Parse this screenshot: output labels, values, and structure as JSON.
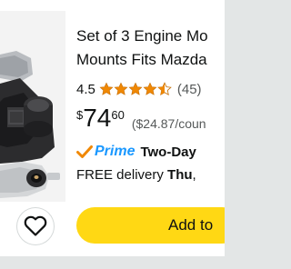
{
  "product": {
    "title_line1": "Set of 3 Engine Mo",
    "title_line2": "Mounts Fits Mazda",
    "rating_value": "4.5",
    "rating_stars": 4.5,
    "review_count": "(45)",
    "price_currency": "$",
    "price_whole": "74",
    "price_fraction": "60",
    "unit_price": "($24.87/coun",
    "prime_label": "Prime",
    "prime_delivery": "Two-Day",
    "delivery_text": "FREE delivery ",
    "delivery_day": "Thu",
    "delivery_suffix": ",",
    "add_to_cart_label": "Add to"
  },
  "icons": {
    "wishlist": "heart-icon",
    "star": "star-icon",
    "prime_check": "checkmark-icon",
    "product_image": "engine-mount-image"
  },
  "colors": {
    "star": "#f08804",
    "prime": "#1a98ff",
    "prime_check": "#f08804",
    "cart_button": "#ffd814",
    "text": "#0f1111",
    "muted": "#565959"
  }
}
